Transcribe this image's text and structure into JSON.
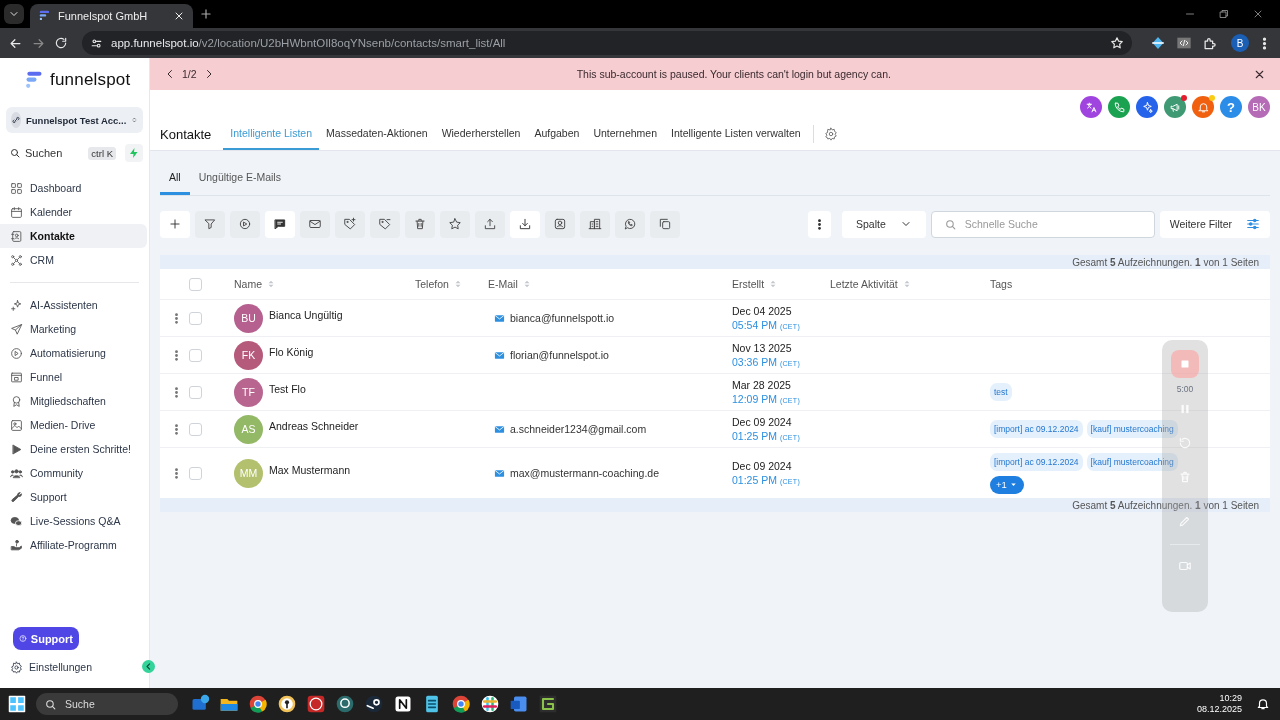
{
  "browser": {
    "tab_title": "Funnelspot GmbH",
    "url_host": "app.funnelspot.io",
    "url_path": "/v2/location/U2bHWbntOIl8oqYNsenb/contacts/smart_list/All",
    "profile": "B"
  },
  "sidebar": {
    "logo": "funnelspot",
    "account": "Funnelspot Test Acc...",
    "search": {
      "placeholder": "Suchen",
      "shortcut": "ctrl K"
    },
    "groups": [
      [
        {
          "label": "Dashboard",
          "selected": false
        },
        {
          "label": "Kalender",
          "selected": false
        },
        {
          "label": "Kontakte",
          "selected": true
        },
        {
          "label": "CRM",
          "selected": false
        }
      ],
      [
        {
          "label": "AI-Assistenten",
          "selected": false
        },
        {
          "label": "Marketing",
          "selected": false
        },
        {
          "label": "Automatisierung",
          "selected": false
        },
        {
          "label": "Funnel",
          "selected": false
        },
        {
          "label": "Mitgliedschaften",
          "selected": false
        },
        {
          "label": "Medien- Drive",
          "selected": false
        },
        {
          "label": "Deine ersten Schritte!",
          "selected": false
        },
        {
          "label": "Community",
          "selected": false
        },
        {
          "label": "Support",
          "selected": false
        },
        {
          "label": "Live-Sessions Q&A",
          "selected": false
        },
        {
          "label": "Affiliate-Programm",
          "selected": false
        }
      ]
    ],
    "support_button": "Support",
    "settings": "Einstellungen"
  },
  "banner": {
    "pager": "1/2",
    "message": "This sub-account is paused. Your clients can't login but agency can."
  },
  "header": {
    "help": "?",
    "avatar": "BK",
    "title": "Kontakte",
    "tabs": [
      {
        "label": "Intelligente Listen",
        "selected": true
      },
      {
        "label": "Massedaten-Aktionen",
        "selected": false
      },
      {
        "label": "Wiederherstellen",
        "selected": false
      },
      {
        "label": "Aufgaben",
        "selected": false
      },
      {
        "label": "Unternehmen",
        "selected": false
      },
      {
        "label": "Intelligente Listen verwalten",
        "selected": false
      }
    ]
  },
  "subtabs": [
    {
      "label": "All",
      "selected": true
    },
    {
      "label": "Ungültige E-Mails",
      "selected": false
    }
  ],
  "toolbar": {
    "buttons": [
      {
        "disabled": false
      },
      {
        "disabled": true
      },
      {
        "disabled": true
      },
      {
        "disabled": false
      },
      {
        "disabled": true
      },
      {
        "disabled": true
      },
      {
        "disabled": true
      },
      {
        "disabled": true
      },
      {
        "disabled": true
      },
      {
        "disabled": true
      },
      {
        "disabled": false
      },
      {
        "disabled": true
      },
      {
        "disabled": true
      },
      {
        "disabled": true
      },
      {
        "disabled": true
      }
    ],
    "column_select": "Spalte",
    "search": {
      "placeholder": "Schnelle Suche"
    },
    "filter_button": "Weitere Filter"
  },
  "summary_top": "Gesamt **5** Aufzeichnungen. **1** von 1 Seiten",
  "table": {
    "select_all": {
      "checked": false
    },
    "columns": [
      {
        "label": "Name",
        "sortable": true
      },
      {
        "label": "Telefon",
        "sortable": true
      },
      {
        "label": "E-Mail",
        "sortable": true
      },
      {
        "label": "Erstellt",
        "sortable": true
      },
      {
        "label": "Letzte Aktivität",
        "sortable": true
      },
      {
        "label": "Tags",
        "sortable": false
      }
    ],
    "rows": [
      {
        "checked": false,
        "initials": "BU",
        "color": "#b5608f",
        "name": "Bianca Ungültig",
        "email": "bianca@funnelspott.io",
        "date": "Dec 04 2025",
        "time": "05:54 PM",
        "tz": "(CET)",
        "tags": []
      },
      {
        "checked": false,
        "initials": "FK",
        "color": "#b55a7a",
        "name": "Flo König",
        "email": "florian@funnelspot.io",
        "date": "Nov 13 2025",
        "time": "03:36 PM",
        "tz": "(CET)",
        "tags": []
      },
      {
        "checked": false,
        "initials": "TF",
        "color": "#b86690",
        "name": "Test Flo",
        "date": "Mar 28 2025",
        "time": "12:09 PM",
        "tz": "(CET)",
        "tags": [
          "test"
        ]
      },
      {
        "checked": false,
        "initials": "AS",
        "color": "#93b866",
        "name": "Andreas Schneider",
        "email": "a.schneider1234@gmail.com",
        "date": "Dec 09 2024",
        "time": "01:25 PM",
        "tz": "(CET)",
        "tags": [
          "[import] ac 09.12.2024",
          "[kauf] mustercoaching"
        ]
      },
      {
        "checked": false,
        "initials": "MM",
        "color": "#b3c06d",
        "name": "Max Mustermann",
        "email": "max@mustermann-coaching.de",
        "date": "Dec 09 2024",
        "time": "01:25 PM",
        "tz": "(CET)",
        "tags": [
          "[import] ac 09.12.2024",
          "[kauf] mustercoaching"
        ],
        "more_tags": "+1"
      }
    ]
  },
  "summary_bottom": "Gesamt **5** Aufzeichnungen. **1** von 1 Seiten",
  "recorder": {
    "timer": "5:00"
  },
  "taskbar": {
    "search": "Suche",
    "time": "10:29",
    "date": "08.12.2025"
  }
}
